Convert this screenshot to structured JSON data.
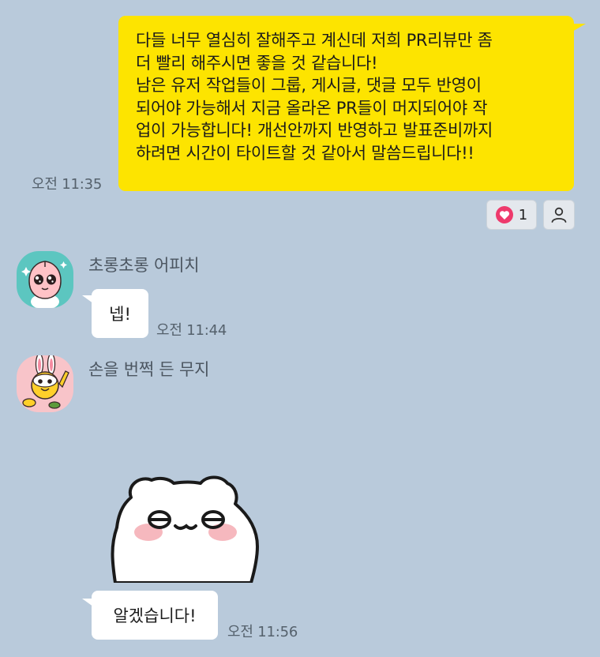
{
  "messages": {
    "outgoing": {
      "text": "다들 너무 열심히 잘해주고 계신데 저희 PR리뷰만 좀\n더 빨리 해주시면 좋을 것 같습니다!\n남은 유저 작업들이 그룹, 게시글, 댓글 모두 반영이\n되어야 가능해서 지금 올라온 PR들이 머지되어야 작\n업이 가능합니다! 개선안까지 반영하고 발표준비까지\n하려면 시간이 타이트할 것 같아서 말씀드립니다!!",
      "time": "오전 11:35",
      "reaction_count": "1",
      "reaction_icon": "heart-icon",
      "member_icon": "person-icon"
    },
    "first_incoming": {
      "sender": "초롱초롱 어피치",
      "text": "넵!",
      "time": "오전 11:44"
    },
    "second_incoming": {
      "sender": "손을 번쩍 든 무지",
      "sticker": "white-bear-sticker",
      "text": "알겠습니다!",
      "time": "오전 11:56"
    }
  },
  "colors": {
    "background": "#b9cadb",
    "my_bubble": "#fde400",
    "other_bubble": "#ffffff",
    "reaction_heart": "#ee3a6c"
  }
}
